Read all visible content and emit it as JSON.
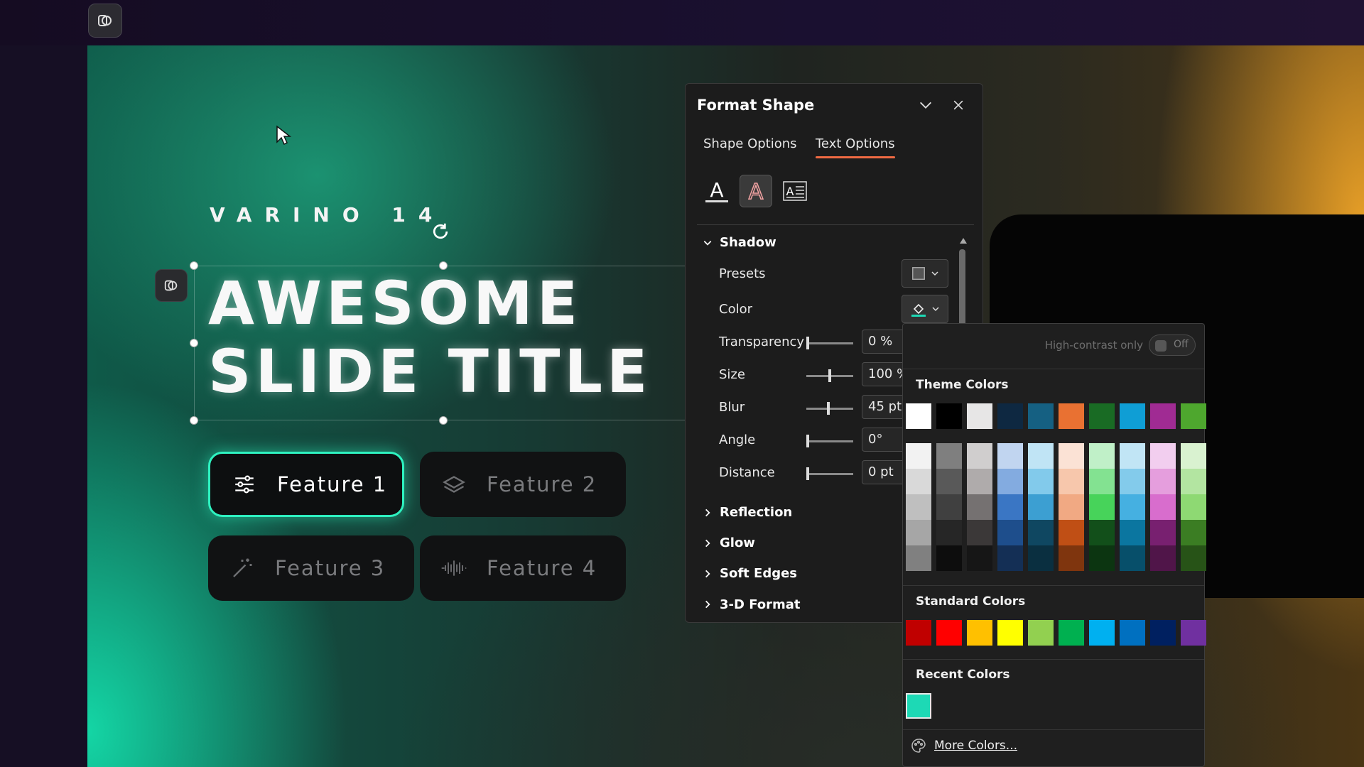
{
  "slide": {
    "subtitle": "VARINO 14",
    "title_line1": "AWESOME",
    "title_line2": "SLIDE TITLE",
    "features": [
      {
        "label": "Feature 1",
        "icon": "sliders-icon",
        "active": true
      },
      {
        "label": "Feature 2",
        "icon": "layers-icon",
        "active": false
      },
      {
        "label": "Feature 3",
        "icon": "magic-wand-icon",
        "active": false
      },
      {
        "label": "Feature 4",
        "icon": "waveform-icon",
        "active": false
      }
    ],
    "accent_color": "#2EF2C0"
  },
  "panel": {
    "title": "Format Shape",
    "tabs": [
      {
        "label": "Shape Options",
        "active": false
      },
      {
        "label": "Text Options",
        "active": true
      }
    ],
    "text_icons": [
      "text-fill-outline-icon",
      "text-effects-icon",
      "textbox-icon"
    ],
    "sections": {
      "shadow": {
        "label": "Shadow",
        "presets_label": "Presets",
        "color_label": "Color",
        "transparency": {
          "label": "Transparency",
          "value": "0 %"
        },
        "size": {
          "label": "Size",
          "value": "100 %"
        },
        "blur": {
          "label": "Blur",
          "value": "45 pt"
        },
        "angle": {
          "label": "Angle",
          "value": "0°"
        },
        "distance": {
          "label": "Distance",
          "value": "0 pt"
        }
      },
      "reflection": "Reflection",
      "glow": "Glow",
      "soft_edges": "Soft Edges",
      "three_d_format": "3-D Format"
    },
    "accent_tab_color": "#F06A43"
  },
  "color_popup": {
    "high_contrast_label": "High-contrast only",
    "toggle_label": "Off",
    "theme_colors_label": "Theme Colors",
    "theme_colors": [
      "#FFFFFF",
      "#000000",
      "#E7E6E6",
      "#0E2841",
      "#156082",
      "#E97132",
      "#196B24",
      "#0F9ED5",
      "#A02B93",
      "#4EA72E"
    ],
    "theme_shades": [
      [
        "#F2F2F2",
        "#D9D9D9",
        "#BFBFBF",
        "#A6A6A6",
        "#808080"
      ],
      [
        "#7F7F7F",
        "#595959",
        "#404040",
        "#262626",
        "#0D0D0D"
      ],
      [
        "#D0CECE",
        "#AFABAB",
        "#757171",
        "#3B3838",
        "#161616"
      ],
      [
        "#C1D5F0",
        "#83ABE0",
        "#3A76C4",
        "#1E4E8C",
        "#142F55"
      ],
      [
        "#C0E4F5",
        "#82CAEB",
        "#3C9FD2",
        "#0F4761",
        "#0A2F40"
      ],
      [
        "#FBE2D5",
        "#F7C7AC",
        "#F1A983",
        "#C04F15",
        "#7F350E"
      ],
      [
        "#C0F0C8",
        "#83E291",
        "#47D35A",
        "#124F1A",
        "#0C3511"
      ],
      [
        "#C1E5F5",
        "#83CBEB",
        "#45B0E1",
        "#0B76A0",
        "#074F6A"
      ],
      [
        "#F2CEEF",
        "#E59EDD",
        "#D86DCD",
        "#782070",
        "#501549"
      ],
      [
        "#D9F2D0",
        "#B3E5A1",
        "#8ED973",
        "#3B7D23",
        "#275317"
      ]
    ],
    "standard_colors_label": "Standard Colors",
    "standard_colors": [
      "#C00000",
      "#FF0000",
      "#FFC000",
      "#FFFF00",
      "#92D050",
      "#00B050",
      "#00B0F0",
      "#0070C0",
      "#002060",
      "#7030A0"
    ],
    "recent_colors_label": "Recent Colors",
    "recent_colors": [
      "#1DD9B5"
    ],
    "more_colors_label": "More Colors..."
  }
}
